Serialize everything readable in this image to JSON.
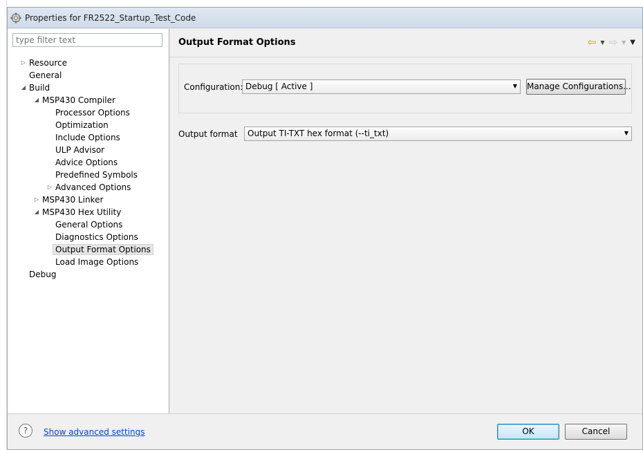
{
  "window": {
    "title": "Properties for FR2522_Startup_Test_Code"
  },
  "filter": {
    "placeholder": "type filter text"
  },
  "tree": [
    {
      "label": "Resource",
      "twisty": "▷"
    },
    {
      "label": "General",
      "twisty": ""
    },
    {
      "label": "Build",
      "twisty": "◢"
    },
    {
      "label": "MSP430 Compiler",
      "twisty": "◢"
    },
    {
      "label": "Processor Options",
      "twisty": ""
    },
    {
      "label": "Optimization",
      "twisty": ""
    },
    {
      "label": "Include Options",
      "twisty": ""
    },
    {
      "label": "ULP Advisor",
      "twisty": ""
    },
    {
      "label": "Advice Options",
      "twisty": ""
    },
    {
      "label": "Predefined Symbols",
      "twisty": ""
    },
    {
      "label": "Advanced Options",
      "twisty": "▷"
    },
    {
      "label": "MSP430 Linker",
      "twisty": "▷"
    },
    {
      "label": "MSP430 Hex Utility",
      "twisty": "◢"
    },
    {
      "label": "General Options",
      "twisty": ""
    },
    {
      "label": "Diagnostics Options",
      "twisty": ""
    },
    {
      "label": "Output Format Options",
      "twisty": "",
      "selected": true
    },
    {
      "label": "Load Image Options",
      "twisty": ""
    },
    {
      "label": "Debug",
      "twisty": ""
    }
  ],
  "page": {
    "title": "Output Format Options",
    "configuration_label": "Configuration:",
    "configuration_value": "Debug  [ Active ]",
    "manage_button": "Manage Configurations...",
    "output_format_label": "Output format",
    "output_format_value": "Output TI-TXT hex format (--ti_txt)"
  },
  "nav": {
    "back_icon": "back-arrow-icon",
    "forward_icon": "forward-arrow-icon"
  },
  "footer": {
    "help_icon": "?",
    "advanced_link": "Show advanced settings",
    "ok": "OK",
    "cancel": "Cancel"
  },
  "colors": {
    "accent": "#0046d5",
    "selection": "#e5e5e5",
    "back_arrow": "#d49b00"
  }
}
